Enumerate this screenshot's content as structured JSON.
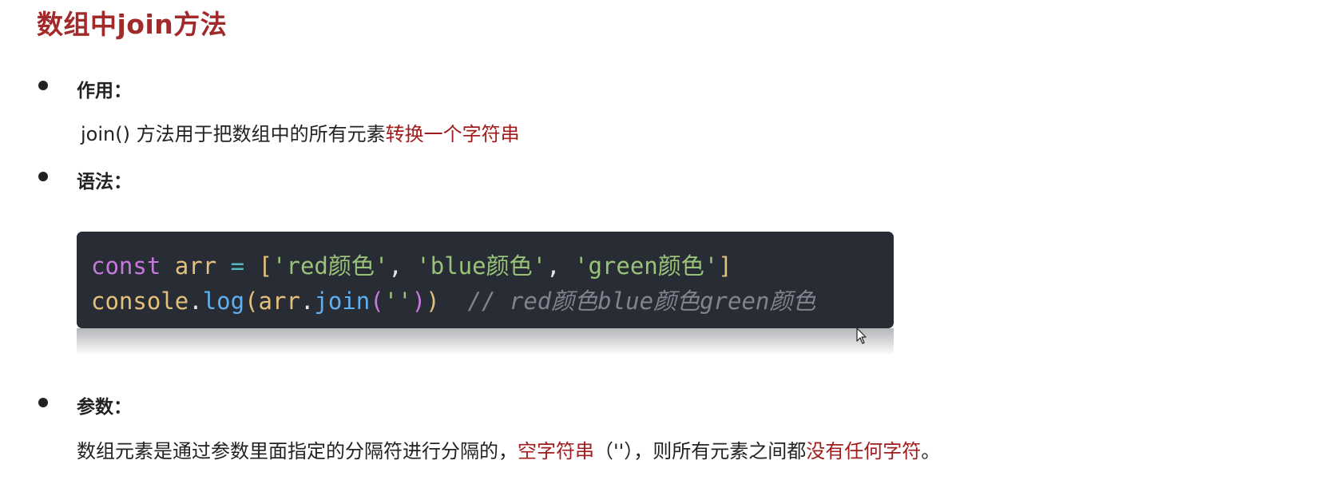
{
  "title": "数组中join方法",
  "sections": [
    {
      "label": "作用：",
      "desc_prefix": "join() 方法用于把数组中的所有元素",
      "desc_highlight": "转换一个字符串"
    },
    {
      "label": "语法："
    },
    {
      "label": "参数：",
      "desc_prefix": "数组元素是通过参数里面指定的分隔符进行分隔的，",
      "desc_highlight1": "空字符串",
      "desc_middle": "（''），则所有元素之间都",
      "desc_highlight2": "没有任何字符",
      "desc_suffix": "。"
    }
  ],
  "code": {
    "line1": {
      "keyword": "const",
      "var": "arr",
      "op": "=",
      "open": "[",
      "s1": "'red颜色'",
      "comma1": ",",
      "s2": "'blue颜色'",
      "comma2": ",",
      "s3": "'green颜色'",
      "close": "]"
    },
    "line2": {
      "obj": "console",
      "dot1": ".",
      "method": "log",
      "p1": "(",
      "arg": "arr",
      "dot2": ".",
      "join": "join",
      "p2": "(",
      "str": "''",
      "p3": ")",
      "p4": ")",
      "comment": "// red颜色blue颜色green颜色"
    }
  },
  "colors": {
    "title": "#a12a2a",
    "highlight": "#a11c1c",
    "code_bg": "#282c34"
  },
  "icons": [
    "bullet-icon",
    "mouse-cursor-icon"
  ]
}
